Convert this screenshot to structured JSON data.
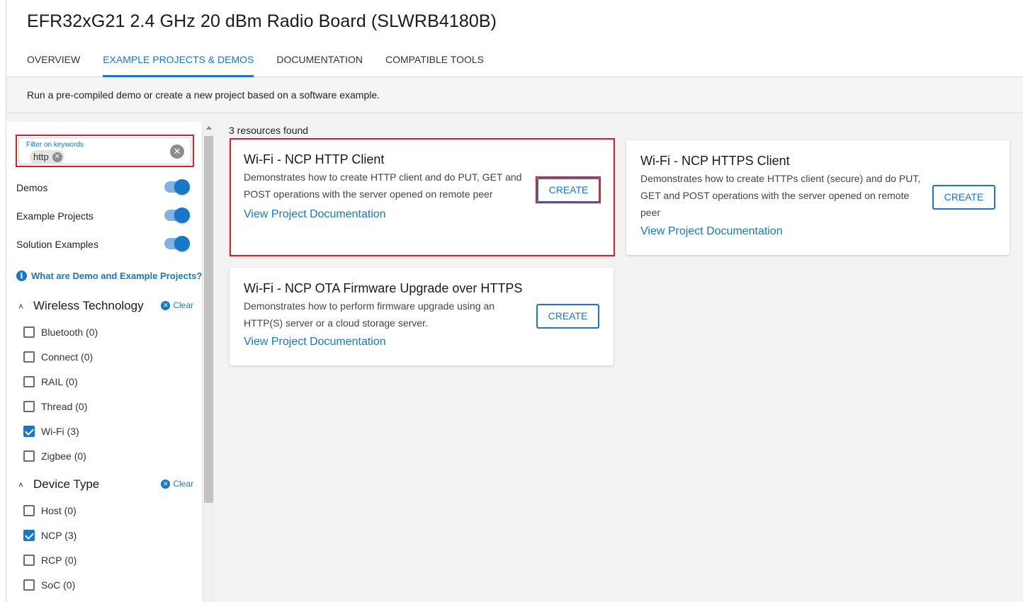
{
  "header": {
    "title": "EFR32xG21 2.4 GHz 20 dBm Radio Board (SLWRB4180B)",
    "tabs": [
      {
        "label": "OVERVIEW",
        "active": false
      },
      {
        "label": "EXAMPLE PROJECTS & DEMOS",
        "active": true
      },
      {
        "label": "DOCUMENTATION",
        "active": false
      },
      {
        "label": "COMPATIBLE TOOLS",
        "active": false
      }
    ]
  },
  "subheader": {
    "text": "Run a pre-compiled demo or create a new project based on a software example."
  },
  "sidebar": {
    "filter": {
      "label": "Filter on keywords",
      "chip": "http"
    },
    "toggles": [
      {
        "label": "Demos",
        "on": true
      },
      {
        "label": "Example Projects",
        "on": true
      },
      {
        "label": "Solution Examples",
        "on": true
      }
    ],
    "help_link": "What are Demo and Example Projects?",
    "sections": [
      {
        "title": "Wireless Technology",
        "clear_label": "Clear",
        "options": [
          {
            "label": "Bluetooth (0)",
            "checked": false
          },
          {
            "label": "Connect (0)",
            "checked": false
          },
          {
            "label": "RAIL (0)",
            "checked": false
          },
          {
            "label": "Thread (0)",
            "checked": false
          },
          {
            "label": "Wi-Fi (3)",
            "checked": true
          },
          {
            "label": "Zigbee (0)",
            "checked": false
          }
        ]
      },
      {
        "title": "Device Type",
        "clear_label": "Clear",
        "options": [
          {
            "label": "Host (0)",
            "checked": false
          },
          {
            "label": "NCP (3)",
            "checked": true
          },
          {
            "label": "RCP (0)",
            "checked": false
          },
          {
            "label": "SoC (0)",
            "checked": false
          }
        ]
      }
    ]
  },
  "results": {
    "count_text": "3 resources found",
    "cards": [
      {
        "title": "Wi-Fi - NCP HTTP Client",
        "desc_lines": [
          "Demonstrates how to create HTTP client and do PUT, GET and",
          "POST operations with the server opened on remote peer"
        ],
        "link": "View Project Documentation",
        "button": "CREATE"
      },
      {
        "title": "Wi-Fi - NCP HTTPS Client",
        "desc_lines": [
          "Demonstrates how to create HTTPs client (secure) and do PUT,",
          "GET and POST operations with the server opened on remote",
          "peer"
        ],
        "link": "View Project Documentation",
        "button": "CREATE"
      },
      {
        "title": "Wi-Fi - NCP OTA Firmware Upgrade over HTTPS",
        "desc_lines": [
          "Demonstrates how to perform firmware upgrade using an",
          "HTTP(S) server or a cloud storage server."
        ],
        "link": "View Project Documentation",
        "button": "CREATE"
      }
    ]
  },
  "colors": {
    "accent": "#1877c9",
    "highlight": "#d9202c"
  }
}
